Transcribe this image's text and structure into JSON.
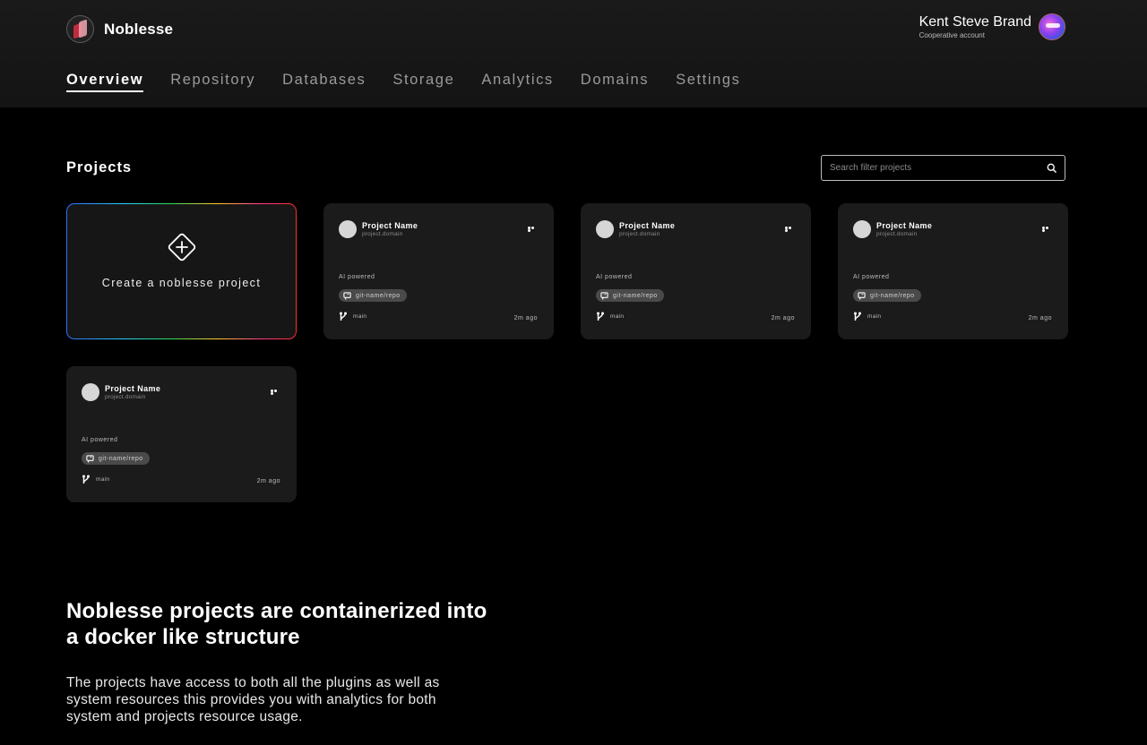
{
  "brand": {
    "name": "Noblesse"
  },
  "user": {
    "name": "Kent Steve Brand",
    "role": "Cooperative account"
  },
  "nav": {
    "items": [
      {
        "label": "Overview",
        "active": true
      },
      {
        "label": "Repository"
      },
      {
        "label": "Databases"
      },
      {
        "label": "Storage"
      },
      {
        "label": "Analytics"
      },
      {
        "label": "Domains"
      },
      {
        "label": "Settings"
      }
    ]
  },
  "projects": {
    "title": "Projects",
    "search_placeholder": "Search filter projects",
    "create_label": "Create a noblesse project",
    "cards": [
      {
        "name": "Project Name",
        "domain": "project.domain",
        "tag": "AI powered",
        "repo": "git-name/repo",
        "branch": "main",
        "updated": "2m ago"
      },
      {
        "name": "Project Name",
        "domain": "project.domain",
        "tag": "AI powered",
        "repo": "git-name/repo",
        "branch": "main",
        "updated": "2m ago"
      },
      {
        "name": "Project Name",
        "domain": "project.domain",
        "tag": "AI powered",
        "repo": "git-name/repo",
        "branch": "main",
        "updated": "2m ago"
      },
      {
        "name": "Project Name",
        "domain": "project.domain",
        "tag": "AI powered",
        "repo": "git-name/repo",
        "branch": "main",
        "updated": "2m ago"
      }
    ]
  },
  "info": {
    "title": "Noblesse projects are containerized into a docker like structure",
    "body": "The projects have access to both all the plugins as well as system resources this provides you with analytics for both system and projects resource usage."
  },
  "colors": {
    "background": "#000000",
    "card": "#1b1b1b",
    "header": "#161616",
    "accent_gradient": [
      "#2d6cff",
      "#2bd95a",
      "#ffd02b",
      "#ff2b2b"
    ]
  }
}
